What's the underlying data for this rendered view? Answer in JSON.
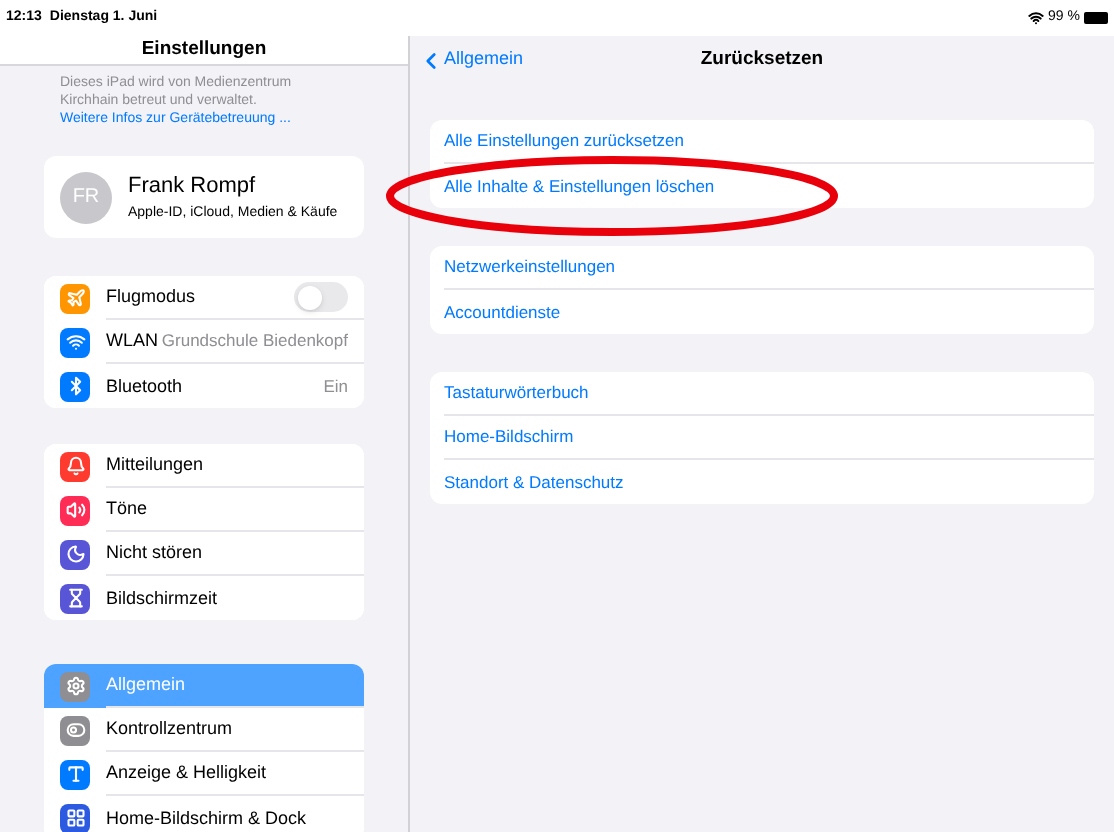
{
  "status_bar": {
    "time": "12:13",
    "date": "Dienstag 1. Juni",
    "battery": "99 %"
  },
  "sidebar": {
    "title": "Einstellungen",
    "notice": "Dieses iPad wird von Medienzentrum Kirchhain betreut und verwaltet.",
    "notice_link": "Weitere Infos zur Gerätebetreuung ...",
    "profile": {
      "initials": "FR",
      "name": "Frank Rompf",
      "subtitle": "Apple-ID, iCloud, Medien & Käufe"
    },
    "groups": [
      [
        {
          "label": "Flugmodus",
          "kind": "toggle",
          "on": false,
          "selected": false,
          "color": "#ff9500"
        },
        {
          "label": "WLAN",
          "kind": "value",
          "value": "Grundschule Biedenkopf",
          "selected": false,
          "color": "#007aff"
        },
        {
          "label": "Bluetooth",
          "kind": "value",
          "value": "Ein",
          "selected": false,
          "color": "#007aff"
        }
      ],
      [
        {
          "label": "Mitteilungen",
          "kind": "plain",
          "selected": false,
          "color": "#ff3b30"
        },
        {
          "label": "Töne",
          "kind": "plain",
          "selected": false,
          "color": "#ff2d55"
        },
        {
          "label": "Nicht stören",
          "kind": "plain",
          "selected": false,
          "color": "#5856d6"
        },
        {
          "label": "Bildschirmzeit",
          "kind": "plain",
          "selected": false,
          "color": "#5856d6"
        }
      ],
      [
        {
          "label": "Allgemein",
          "kind": "plain",
          "selected": true,
          "color": "#8e8e93"
        },
        {
          "label": "Kontrollzentrum",
          "kind": "plain",
          "selected": false,
          "color": "#8e8e93"
        },
        {
          "label": "Anzeige & Helligkeit",
          "kind": "plain",
          "selected": false,
          "color": "#007aff"
        },
        {
          "label": "Home-Bildschirm & Dock",
          "kind": "plain",
          "selected": false,
          "color": "#2c5ae0"
        }
      ]
    ]
  },
  "detail": {
    "back": "Allgemein",
    "title": "Zurücksetzen",
    "groups": [
      [
        "Alle Einstellungen zurücksetzen",
        "Alle Inhalte & Einstellungen löschen"
      ],
      [
        "Netzwerkeinstellungen",
        "Accountdienste"
      ],
      [
        "Tastaturwörterbuch",
        "Home-Bildschirm",
        "Standort & Datenschutz"
      ]
    ]
  }
}
